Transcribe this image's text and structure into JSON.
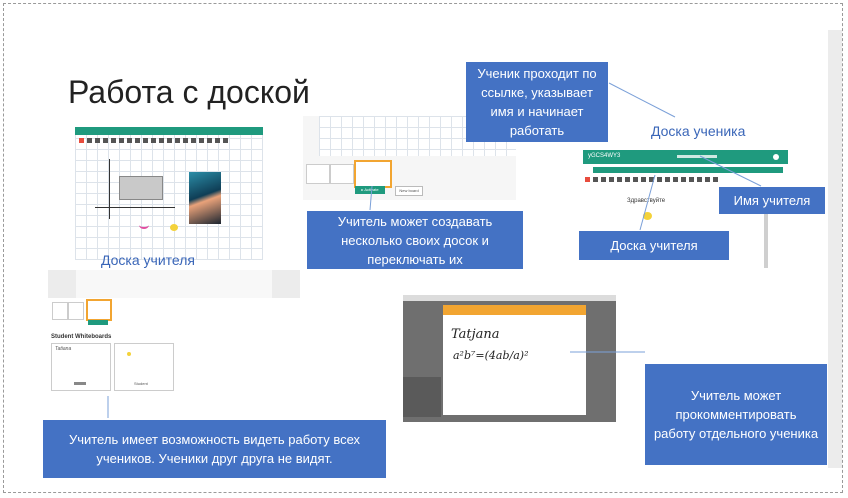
{
  "slide": {
    "title": "Работа с доской"
  },
  "captions": {
    "teacher_board": "Доска учителя",
    "student_board": "Доска ученика"
  },
  "callouts": {
    "student_link": "Ученик проходит по ссылке, указывает имя и начинает работать",
    "multiple_boards": "Учитель может создавать несколько своих досок и переключать их",
    "teacher_name": "Имя учителя",
    "teacher_board": "Доска учителя",
    "see_all_work": "Учитель имеет возможность видеть работу всех учеников. Ученики друг друга не видят.",
    "comment_work": "Учитель может прокомментировать работу отдельного ученика"
  },
  "screenshots": {
    "student_whiteboards_heading": "Student Whiteboards",
    "student_card_name": "Tatiana",
    "student_card_name_2": "Student",
    "student_header_code": "yGCS4WY3",
    "greeting": "Здравствуйте",
    "handwriting_line1": "Tatjana",
    "handwriting_line2": "a²b⁷=(4ab/a)²",
    "switch_button": "▸ Activate",
    "add_button": "New board"
  },
  "colors": {
    "callout_bg": "#4472c4",
    "accent_teal": "#1f9a7e",
    "accent_orange": "#f2a531",
    "caption_blue": "#3a66b8"
  }
}
